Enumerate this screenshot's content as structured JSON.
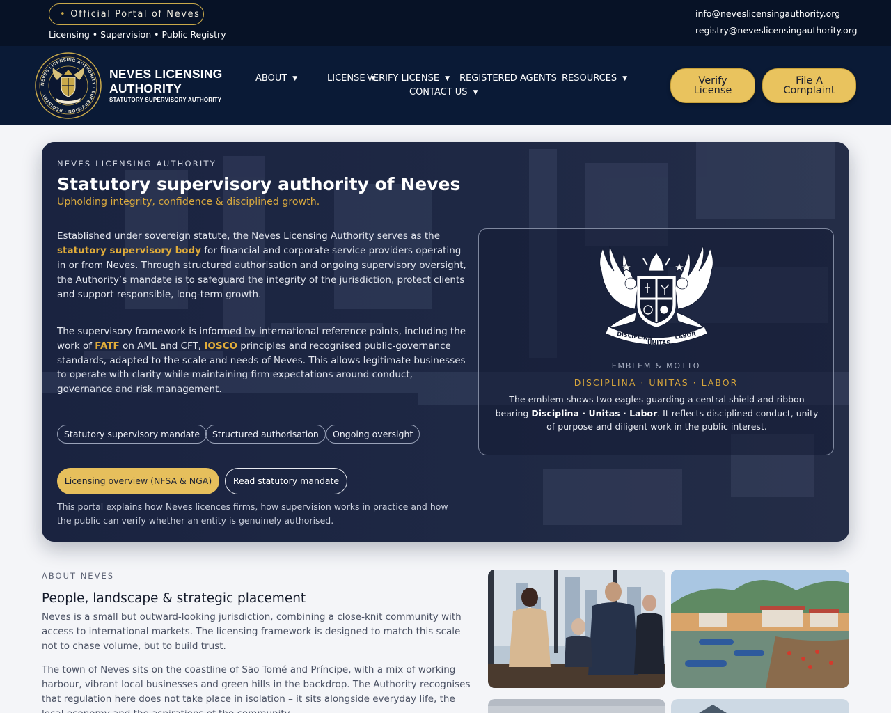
{
  "topbar": {
    "portal_label": "Official Portal of Neves",
    "tagline": "Licensing • Supervision • Public Registry",
    "email_info": "info@neveslicensingauthority.org",
    "email_registry": "registry@neveslicensingauthority.org"
  },
  "header": {
    "brand_name": "NEVES LICENSING AUTHORITY",
    "brand_sub": "STATUTORY SUPERVISORY AUTHORITY",
    "seal_text": "NEVES LICENSING AUTHORITY · SUPERVISION · REGISTRY",
    "nav": {
      "about": "ABOUT",
      "license": "LICENSE",
      "verify": "VERIFY LICENSE",
      "agents": "REGISTERED AGENTS",
      "resources": "RESOURCES",
      "contact": "CONTACT US"
    },
    "btn_verify": "Verify License",
    "btn_complaint": "File A Complaint"
  },
  "hero": {
    "kicker": "NEVES LICENSING AUTHORITY",
    "title": "Statutory supervisory authority of Neves",
    "subtitle": "Upholding integrity, confidence & disciplined growth.",
    "p1_a": "Established under sovereign statute, the Neves Licensing Authority serves as the ",
    "p1_hl": "statutory supervisory body",
    "p1_b": " for financial and corporate service providers operating in or from Neves. Through structured authorisation and ongoing supervisory oversight, the Authority’s mandate is to safeguard the integrity of the jurisdiction, protect clients and support responsible, long-term growth.",
    "p2_a": "The supervisory framework is informed by international reference points, including the work of ",
    "p2_fatf": "FATF",
    "p2_b": " on AML and CFT, ",
    "p2_iosco": "IOSCO",
    "p2_c": " principles and recognised public-governance standards, adapted to the scale and needs of Neves. This allows legitimate businesses to operate with clarity while maintaining firm expectations around conduct, governance and risk management.",
    "chips": [
      "Statutory supervisory mandate",
      "Structured authorisation",
      "Ongoing oversight"
    ],
    "cta_primary": "Licensing overview (NFSA & NGA)",
    "cta_secondary": "Read statutory mandate",
    "note": "This portal explains how Neves licences firms, how supervision works in practice and how the public can verify whether an entity is genuinely authorised."
  },
  "emblem": {
    "ribbon_left": "DISCIPLINA",
    "ribbon_center": "UNITAS",
    "ribbon_right": "LABOR",
    "label": "EMBLEM & MOTTO",
    "motto": "DISCIPLINA · UNITAS · LABOR",
    "desc_a": "The emblem shows two eagles guarding a central shield and ribbon bearing ",
    "desc_bold": "Disciplina · Unitas · Labor",
    "desc_b": ". It reflects disciplined conduct, unity of purpose and diligent work in the public interest."
  },
  "about": {
    "kicker": "ABOUT NEVES",
    "title": "People, landscape & strategic placement",
    "p1": "Neves is a small but outward-looking jurisdiction, combining a close-knit community with access to international markets. The licensing framework is designed to match this scale – not to chase volume, but to build trust.",
    "p2": "The town of Neves sits on the coastline of São Tomé and Príncipe, with a mix of working harbour, vibrant local businesses and green hills in the backdrop. The Authority recognises that regulation here does not take place in isolation – it sits alongside everyday life, the local economy and the aspirations of the community."
  },
  "colors": {
    "navy_top": "#071226",
    "navy_header": "#0a1a36",
    "gold": "#e6bf5c",
    "gold_text": "#d9a93e"
  }
}
